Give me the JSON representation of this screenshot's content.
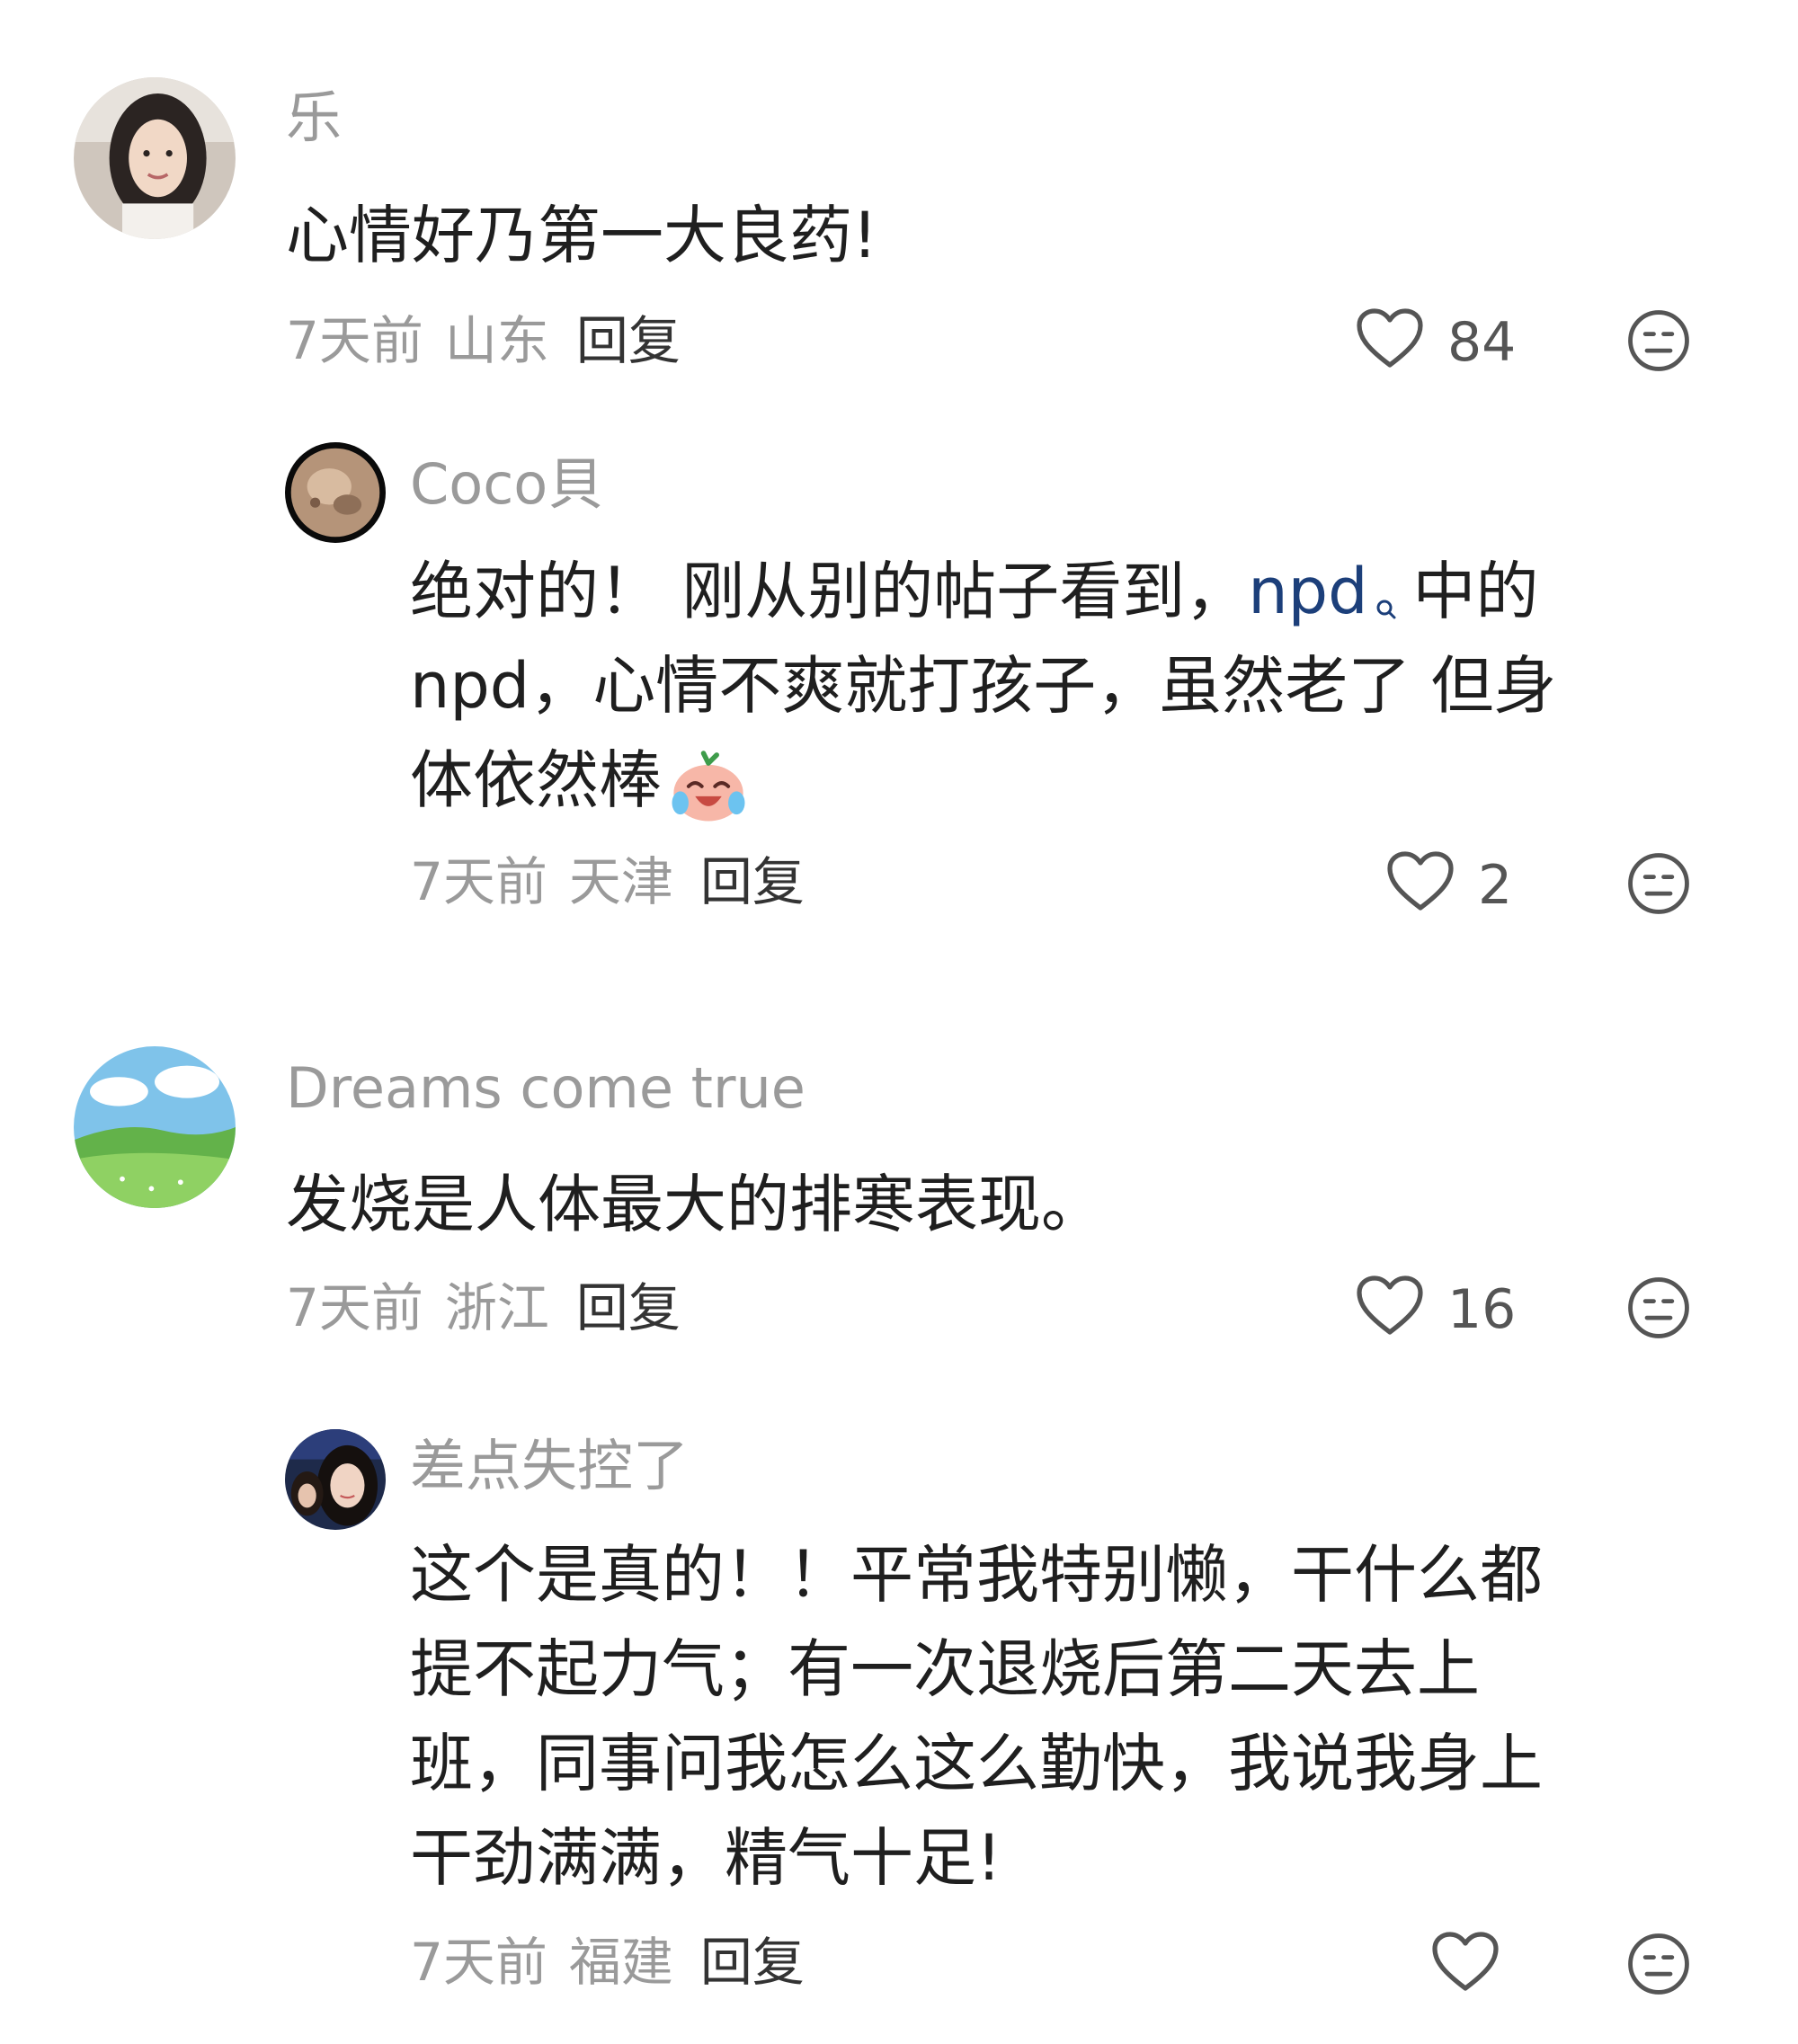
{
  "comments": [
    {
      "name": "乐",
      "text": "心情好乃第一大良药!",
      "time": "7天前",
      "location": "山东",
      "reply_label": "回复",
      "likes": "84",
      "replies": [
        {
          "name": "Coco貝",
          "text_part1": "绝对的！ 刚从别的帖子看到，",
          "link_text": "npd",
          "text_part2": "中的",
          "line2": "npd，心情不爽就打孩子，虽然老了 但身",
          "line3": "体依然棒",
          "time": "7天前",
          "location": "天津",
          "reply_label": "回复",
          "likes": "2"
        }
      ]
    },
    {
      "name": "Dreams come true",
      "text": "发烧是人体最大的排寒表现。",
      "time": "7天前",
      "location": "浙江",
      "reply_label": "回复",
      "likes": "16",
      "replies": [
        {
          "name": "差点失控了",
          "line1": "这个是真的！！平常我特别懒，干什么都",
          "line2": "提不起力气；有一次退烧后第二天去上",
          "line3": "班，同事问我怎么这么勤快，我说我身上",
          "line4": "干劲满满，精气十足!",
          "time": "7天前",
          "location": "福建",
          "reply_label": "回复",
          "likes": ""
        }
      ]
    }
  ],
  "icons": {
    "like": "heart-outline-icon",
    "dislike": "neutral-face-icon",
    "search": "search-icon",
    "emoji": "laughing-crying-emoji"
  },
  "colors": {
    "link": "#1c3f7a",
    "muted": "#9a9a9a",
    "text": "#1f1f1f"
  }
}
